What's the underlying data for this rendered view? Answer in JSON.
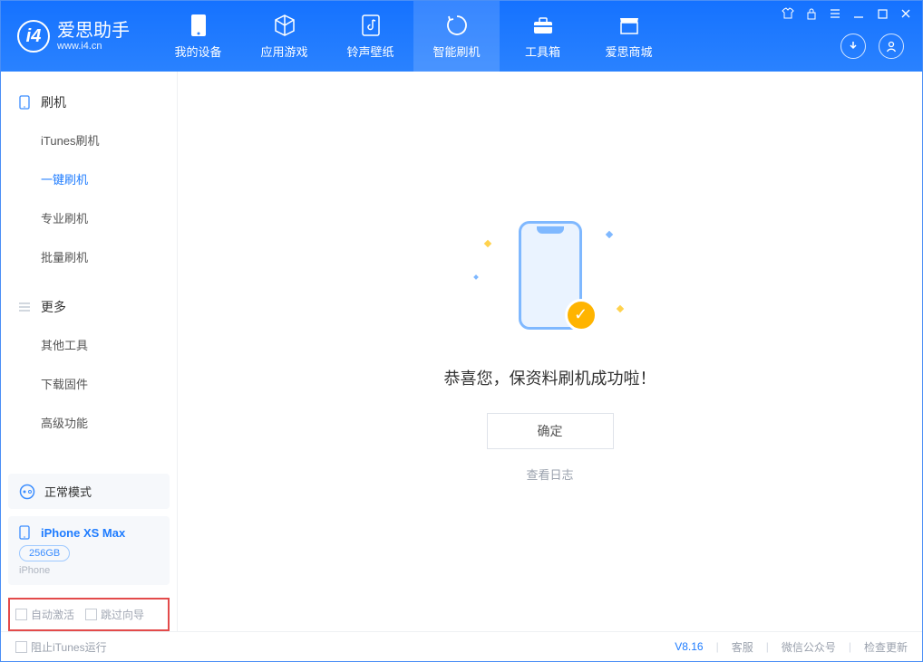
{
  "brand": {
    "name": "爱思助手",
    "url": "www.i4.cn"
  },
  "nav": {
    "tabs": [
      {
        "label": "我的设备"
      },
      {
        "label": "应用游戏"
      },
      {
        "label": "铃声壁纸"
      },
      {
        "label": "智能刷机"
      },
      {
        "label": "工具箱"
      },
      {
        "label": "爱思商城"
      }
    ]
  },
  "sidebar": {
    "group1": {
      "title": "刷机",
      "items": [
        {
          "label": "iTunes刷机"
        },
        {
          "label": "一键刷机"
        },
        {
          "label": "专业刷机"
        },
        {
          "label": "批量刷机"
        }
      ]
    },
    "group2": {
      "title": "更多",
      "items": [
        {
          "label": "其他工具"
        },
        {
          "label": "下载固件"
        },
        {
          "label": "高级功能"
        }
      ]
    },
    "status": {
      "label": "正常模式"
    },
    "device": {
      "name": "iPhone XS Max",
      "storage": "256GB",
      "type": "iPhone"
    },
    "checks": {
      "autoActivate": "自动激活",
      "skipGuide": "跳过向导"
    }
  },
  "main": {
    "successMessage": "恭喜您，保资料刷机成功啦！",
    "okButton": "确定",
    "logLink": "查看日志"
  },
  "footer": {
    "blockItunes": "阻止iTunes运行",
    "version": "V8.16",
    "links": {
      "service": "客服",
      "wechat": "微信公众号",
      "update": "检查更新"
    }
  }
}
